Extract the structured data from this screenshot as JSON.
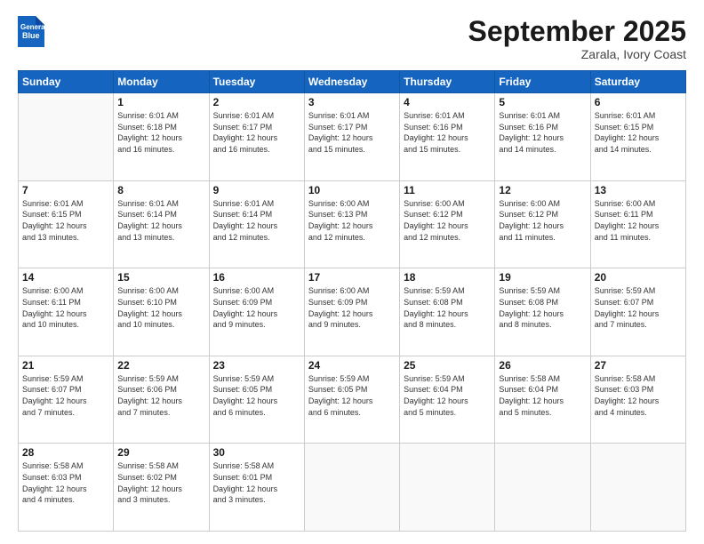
{
  "header": {
    "logo_line1": "General",
    "logo_line2": "Blue",
    "month": "September 2025",
    "location": "Zarala, Ivory Coast"
  },
  "weekdays": [
    "Sunday",
    "Monday",
    "Tuesday",
    "Wednesday",
    "Thursday",
    "Friday",
    "Saturday"
  ],
  "weeks": [
    [
      {
        "day": "",
        "info": ""
      },
      {
        "day": "1",
        "info": "Sunrise: 6:01 AM\nSunset: 6:18 PM\nDaylight: 12 hours\nand 16 minutes."
      },
      {
        "day": "2",
        "info": "Sunrise: 6:01 AM\nSunset: 6:17 PM\nDaylight: 12 hours\nand 16 minutes."
      },
      {
        "day": "3",
        "info": "Sunrise: 6:01 AM\nSunset: 6:17 PM\nDaylight: 12 hours\nand 15 minutes."
      },
      {
        "day": "4",
        "info": "Sunrise: 6:01 AM\nSunset: 6:16 PM\nDaylight: 12 hours\nand 15 minutes."
      },
      {
        "day": "5",
        "info": "Sunrise: 6:01 AM\nSunset: 6:16 PM\nDaylight: 12 hours\nand 14 minutes."
      },
      {
        "day": "6",
        "info": "Sunrise: 6:01 AM\nSunset: 6:15 PM\nDaylight: 12 hours\nand 14 minutes."
      }
    ],
    [
      {
        "day": "7",
        "info": "Sunrise: 6:01 AM\nSunset: 6:15 PM\nDaylight: 12 hours\nand 13 minutes."
      },
      {
        "day": "8",
        "info": "Sunrise: 6:01 AM\nSunset: 6:14 PM\nDaylight: 12 hours\nand 13 minutes."
      },
      {
        "day": "9",
        "info": "Sunrise: 6:01 AM\nSunset: 6:14 PM\nDaylight: 12 hours\nand 12 minutes."
      },
      {
        "day": "10",
        "info": "Sunrise: 6:00 AM\nSunset: 6:13 PM\nDaylight: 12 hours\nand 12 minutes."
      },
      {
        "day": "11",
        "info": "Sunrise: 6:00 AM\nSunset: 6:12 PM\nDaylight: 12 hours\nand 12 minutes."
      },
      {
        "day": "12",
        "info": "Sunrise: 6:00 AM\nSunset: 6:12 PM\nDaylight: 12 hours\nand 11 minutes."
      },
      {
        "day": "13",
        "info": "Sunrise: 6:00 AM\nSunset: 6:11 PM\nDaylight: 12 hours\nand 11 minutes."
      }
    ],
    [
      {
        "day": "14",
        "info": "Sunrise: 6:00 AM\nSunset: 6:11 PM\nDaylight: 12 hours\nand 10 minutes."
      },
      {
        "day": "15",
        "info": "Sunrise: 6:00 AM\nSunset: 6:10 PM\nDaylight: 12 hours\nand 10 minutes."
      },
      {
        "day": "16",
        "info": "Sunrise: 6:00 AM\nSunset: 6:09 PM\nDaylight: 12 hours\nand 9 minutes."
      },
      {
        "day": "17",
        "info": "Sunrise: 6:00 AM\nSunset: 6:09 PM\nDaylight: 12 hours\nand 9 minutes."
      },
      {
        "day": "18",
        "info": "Sunrise: 5:59 AM\nSunset: 6:08 PM\nDaylight: 12 hours\nand 8 minutes."
      },
      {
        "day": "19",
        "info": "Sunrise: 5:59 AM\nSunset: 6:08 PM\nDaylight: 12 hours\nand 8 minutes."
      },
      {
        "day": "20",
        "info": "Sunrise: 5:59 AM\nSunset: 6:07 PM\nDaylight: 12 hours\nand 7 minutes."
      }
    ],
    [
      {
        "day": "21",
        "info": "Sunrise: 5:59 AM\nSunset: 6:07 PM\nDaylight: 12 hours\nand 7 minutes."
      },
      {
        "day": "22",
        "info": "Sunrise: 5:59 AM\nSunset: 6:06 PM\nDaylight: 12 hours\nand 7 minutes."
      },
      {
        "day": "23",
        "info": "Sunrise: 5:59 AM\nSunset: 6:05 PM\nDaylight: 12 hours\nand 6 minutes."
      },
      {
        "day": "24",
        "info": "Sunrise: 5:59 AM\nSunset: 6:05 PM\nDaylight: 12 hours\nand 6 minutes."
      },
      {
        "day": "25",
        "info": "Sunrise: 5:59 AM\nSunset: 6:04 PM\nDaylight: 12 hours\nand 5 minutes."
      },
      {
        "day": "26",
        "info": "Sunrise: 5:58 AM\nSunset: 6:04 PM\nDaylight: 12 hours\nand 5 minutes."
      },
      {
        "day": "27",
        "info": "Sunrise: 5:58 AM\nSunset: 6:03 PM\nDaylight: 12 hours\nand 4 minutes."
      }
    ],
    [
      {
        "day": "28",
        "info": "Sunrise: 5:58 AM\nSunset: 6:03 PM\nDaylight: 12 hours\nand 4 minutes."
      },
      {
        "day": "29",
        "info": "Sunrise: 5:58 AM\nSunset: 6:02 PM\nDaylight: 12 hours\nand 3 minutes."
      },
      {
        "day": "30",
        "info": "Sunrise: 5:58 AM\nSunset: 6:01 PM\nDaylight: 12 hours\nand 3 minutes."
      },
      {
        "day": "",
        "info": ""
      },
      {
        "day": "",
        "info": ""
      },
      {
        "day": "",
        "info": ""
      },
      {
        "day": "",
        "info": ""
      }
    ]
  ]
}
